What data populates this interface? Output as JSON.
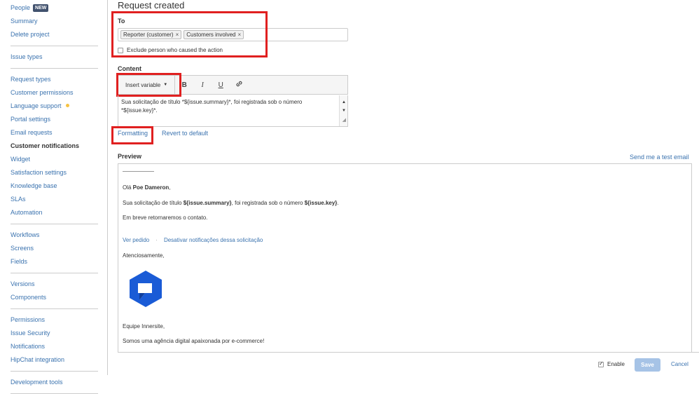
{
  "sidebar": {
    "groups": [
      [
        {
          "label": "People",
          "badge": "NEW"
        },
        {
          "label": "Summary"
        },
        {
          "label": "Delete project"
        }
      ],
      [
        {
          "label": "Issue types"
        }
      ],
      [
        {
          "label": "Request types"
        },
        {
          "label": "Customer permissions"
        },
        {
          "label": "Language support"
        },
        {
          "label": "Portal settings"
        },
        {
          "label": "Email requests"
        },
        {
          "label": "Customer notifications"
        },
        {
          "label": "Widget"
        },
        {
          "label": "Satisfaction settings"
        },
        {
          "label": "Knowledge base"
        },
        {
          "label": "SLAs"
        },
        {
          "label": "Automation"
        }
      ],
      [
        {
          "label": "Workflows"
        },
        {
          "label": "Screens"
        },
        {
          "label": "Fields"
        }
      ],
      [
        {
          "label": "Versions"
        },
        {
          "label": "Components"
        }
      ],
      [
        {
          "label": "Permissions"
        },
        {
          "label": "Issue Security"
        },
        {
          "label": "Notifications"
        },
        {
          "label": "HipChat integration"
        }
      ],
      [
        {
          "label": "Development tools"
        }
      ]
    ],
    "active": "Customer notifications",
    "dot_item": "Language support",
    "dot_color": "#f6c342"
  },
  "page_title": "Request created",
  "to": {
    "label": "To",
    "recipients": [
      "Reporter (customer)",
      "Customers involved"
    ],
    "remove_symbol": "×",
    "exclude_label": "Exclude person who caused the action"
  },
  "content": {
    "label": "Content",
    "insert_variable": "Insert variable",
    "bold": "B",
    "italic": "I",
    "underline": "U",
    "text_line1": "Sua solicitação de título *${issue.summary}*, foi registrada sob o número",
    "text_line2": "*${issue.key}*."
  },
  "links": {
    "formatting": "Formatting",
    "revert": "Revert to default",
    "send_test": "Send me a test email"
  },
  "preview": {
    "label": "Preview",
    "greeting_prefix": "Olá ",
    "greeting_name": "Poe Dameron",
    "greeting_suffix": ",",
    "body_prefix": "Sua solicitação de título ",
    "body_var1": "${issue.summary}",
    "body_mid": ", foi registrada sob o número ",
    "body_var2": "${issue.key}",
    "body_suffix": ".",
    "contact": "Em breve retornaremos o contato.",
    "view_request": "Ver pedido",
    "link_sep": "·",
    "disable_notifications": "Desativar notificações dessa solicitação",
    "regards": "Atenciosamente,",
    "team": "Equipe Innersite,",
    "tagline": "Somos uma agência digital apaixonada por e-commerce!",
    "logo_color": "#1a5bd6"
  },
  "footer": {
    "enable_label": "Enable",
    "save_label": "Save",
    "cancel_label": "Cancel"
  },
  "colors": {
    "link": "#3b73af",
    "highlight": "#e02020",
    "save_disabled": "#a6c3e6"
  }
}
